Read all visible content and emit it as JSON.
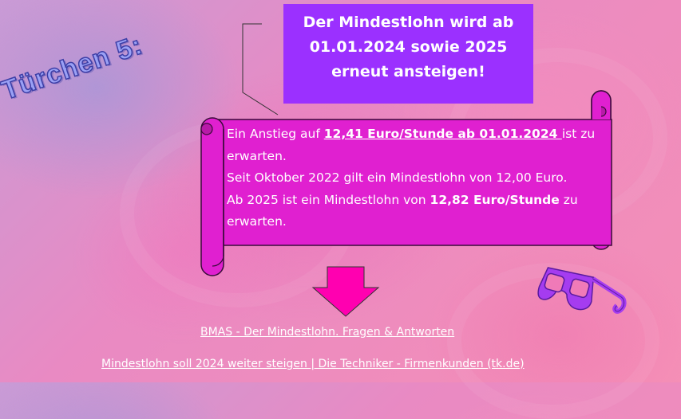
{
  "slide": {
    "side_title": "Türchen 5:",
    "headline": [
      "Der Mindestlohn wird ab",
      "01.01.2024 sowie 2025",
      "erneut ansteigen!"
    ],
    "scroll": {
      "line1_prefix": "Ein Anstieg auf ",
      "line1_highlight": "12,41 Euro/Stunde ab 01.01.2024 ",
      "line1_suffix": "ist zu erwarten.",
      "line2": "Seit Oktober 2022 gilt ein Mindestlohn von 12,00 Euro.",
      "line3_prefix": "Ab 2025 ist ein Mindestlohn von ",
      "line3_highlight": "12,82 Euro/Stunde",
      "line3_suffix": " zu erwarten."
    },
    "links": [
      "BMAS - Der Mindestlohn. Fragen & Antworten",
      "Mindestlohn soll 2024 weiter steigen | Die Techniker - Firmenkunden (tk.de)"
    ]
  },
  "colors": {
    "headline_bg": "#9b30ff",
    "scroll_fill": "#e020d0",
    "arrow_fill": "#ff00b0",
    "title_fill": "#9aa0f5",
    "glasses_fill": "#a53cf0"
  },
  "icons": [
    "down-arrow-icon",
    "3d-glasses-icon"
  ]
}
